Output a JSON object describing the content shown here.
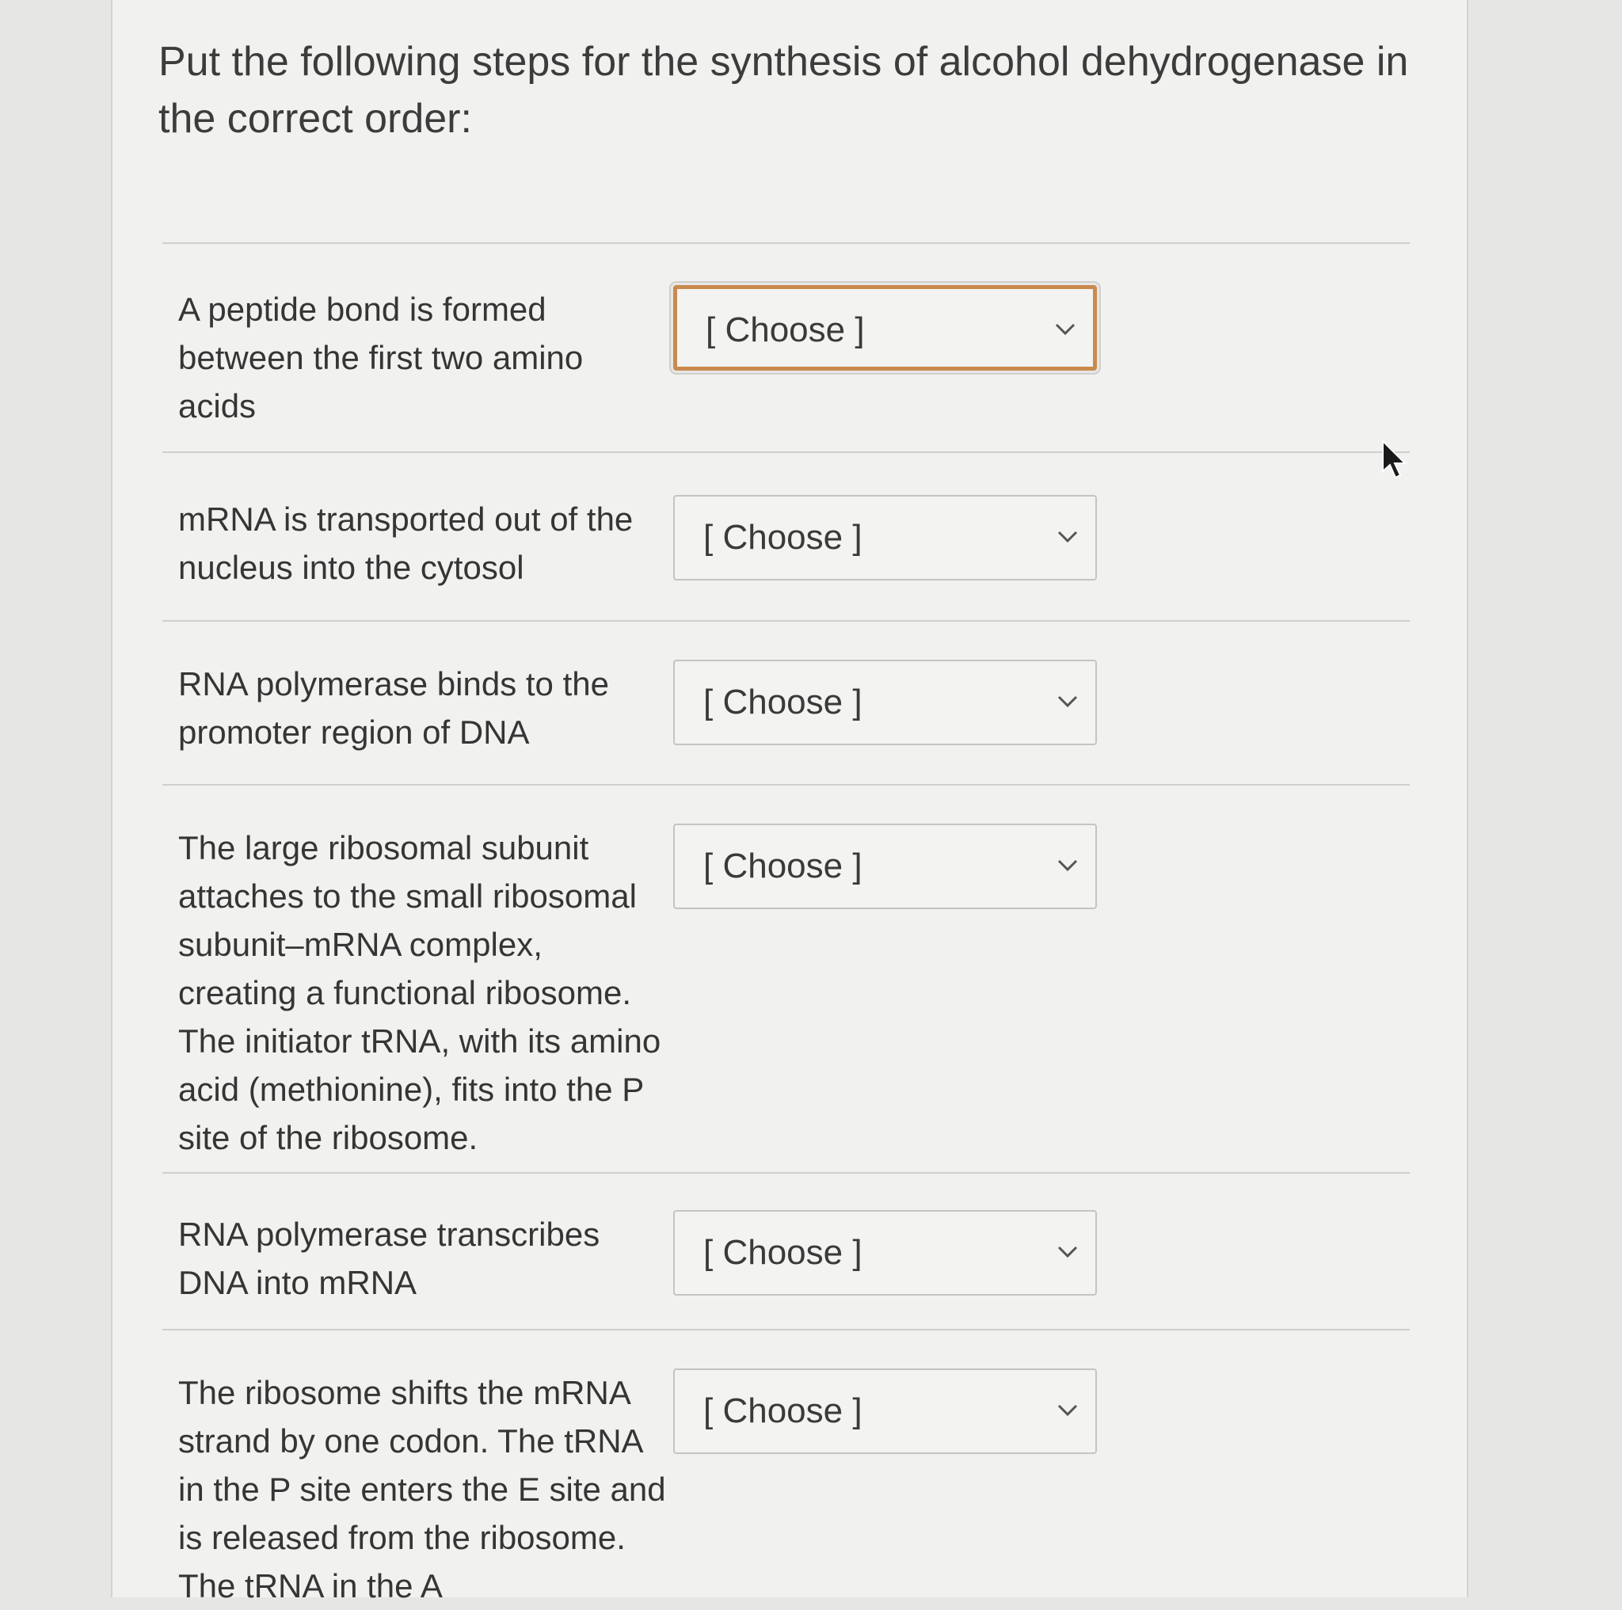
{
  "question": {
    "text": "Put the following steps for the synthesis of alcohol dehydrogenase in the correct order:"
  },
  "steps": [
    {
      "text": "A peptide bond is formed between the first two amino acids",
      "select_value": "[ Choose ]"
    },
    {
      "text": "mRNA is transported out of the nucleus into the cytosol",
      "select_value": "[ Choose ]"
    },
    {
      "text": "RNA polymerase binds to the promoter region of DNA",
      "select_value": "[ Choose ]"
    },
    {
      "text": "The large ribosomal subunit attaches to the small ribosomal subunit–mRNA complex, creating a functional ribosome. The initiator tRNA, with its amino acid (methionine), fits into the P site of the ribosome.",
      "select_value": "[ Choose ]"
    },
    {
      "text": "RNA polymerase transcribes DNA into mRNA",
      "select_value": "[ Choose ]"
    },
    {
      "text": "The ribosome shifts the mRNA strand by one codon. The tRNA in the P site enters the E site and is released from the ribosome. The tRNA in the A",
      "select_value": "[ Choose ]"
    }
  ],
  "icons": {
    "dropdown": "chevron-down-icon",
    "cursor": "mouse-pointer-icon"
  },
  "colors": {
    "focus_border": "#c98a4e"
  }
}
